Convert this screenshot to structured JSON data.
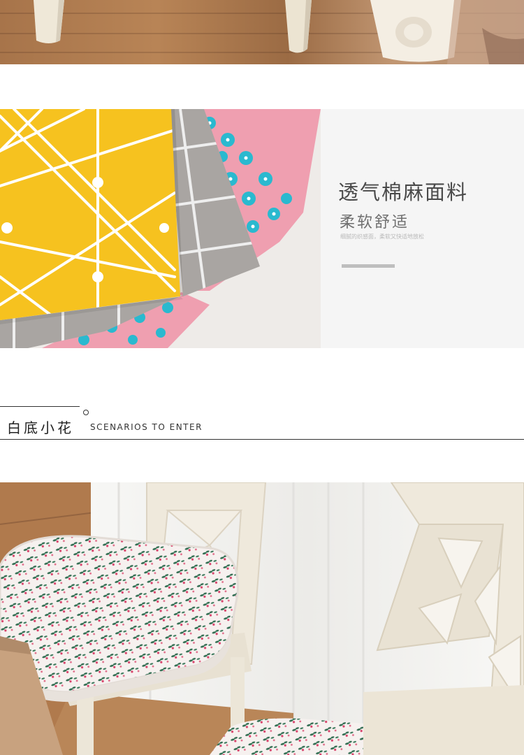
{
  "fabric_feature": {
    "title": "透气棉麻面料",
    "subtitle": "柔软舒适",
    "note": "细腻的织感面，柔软又快适地放松"
  },
  "section_heading": {
    "title_cn": "白底小花",
    "title_en": "SCENARIOS TO ENTER"
  },
  "colors": {
    "fabric_yellow": "#f6c21f",
    "fabric_gray": "#a9a5a2",
    "fabric_pink": "#ef9fb0",
    "flower_teal": "#2ab9cf",
    "wood_floor": "#b07a4d",
    "chair_cream": "#efe9dc",
    "accent_bar": "#bebebe"
  }
}
